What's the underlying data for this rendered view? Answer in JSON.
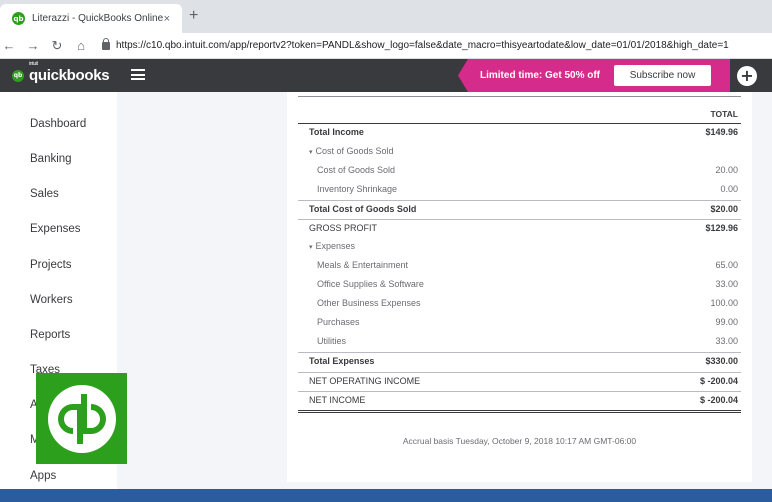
{
  "browser": {
    "tab_title": "Literazzi - QuickBooks Online",
    "tab_close": "×",
    "new_tab": "+",
    "favicon": "qb",
    "url": "https://c10.qbo.intuit.com/app/reportv2?token=PANDL&show_logo=false&date_macro=thisyeartodate&low_date=01/01/2018&high_date=1",
    "nav": {
      "back": "←",
      "forward": "→",
      "reload": "↻",
      "home": "⌂"
    }
  },
  "header": {
    "logo_badge": "qb",
    "logo_intuit": "intuit",
    "logo_text": "quickbooks",
    "promo_text": "Limited time: Get 50% off",
    "subscribe_label": "Subscribe now",
    "plus": "+"
  },
  "sidebar": {
    "items": [
      {
        "label": "Dashboard"
      },
      {
        "label": "Banking"
      },
      {
        "label": "Sales"
      },
      {
        "label": "Expenses"
      },
      {
        "label": "Projects"
      },
      {
        "label": "Workers"
      },
      {
        "label": "Reports"
      },
      {
        "label": "Taxes"
      },
      {
        "label": "A"
      },
      {
        "label": "M"
      },
      {
        "label": "Apps"
      }
    ]
  },
  "report": {
    "column_header": "TOTAL",
    "rows": [
      {
        "label": "Total Income",
        "value": "$149.96",
        "style": "bold",
        "indent": 0
      },
      {
        "label": "Cost of Goods Sold",
        "value": "",
        "style": "plain",
        "indent": 0,
        "caret": "▾"
      },
      {
        "label": "Cost of Goods Sold",
        "value": "20.00",
        "style": "plain",
        "indent": 1
      },
      {
        "label": "Inventory Shrinkage",
        "value": "0.00",
        "style": "plain",
        "indent": 1
      },
      {
        "label": "Total Cost of Goods Sold",
        "value": "$20.00",
        "style": "total",
        "indent": 0
      },
      {
        "label": "GROSS PROFIT",
        "value": "$129.96",
        "style": "net",
        "indent": 0
      },
      {
        "label": "Expenses",
        "value": "",
        "style": "plain",
        "indent": 0,
        "caret": "▾"
      },
      {
        "label": "Meals & Entertainment",
        "value": "65.00",
        "style": "plain",
        "indent": 1
      },
      {
        "label": "Office Supplies & Software",
        "value": "33.00",
        "style": "plain",
        "indent": 1
      },
      {
        "label": "Other Business Expenses",
        "value": "100.00",
        "style": "plain",
        "indent": 1
      },
      {
        "label": "Purchases",
        "value": "99.00",
        "style": "plain",
        "indent": 1
      },
      {
        "label": "Utilities",
        "value": "33.00",
        "style": "plain",
        "indent": 1
      },
      {
        "label": "Total Expenses",
        "value": "$330.00",
        "style": "total",
        "indent": 0
      },
      {
        "label": "NET OPERATING INCOME",
        "value": "$ -200.04",
        "style": "net",
        "indent": 0
      },
      {
        "label": "NET INCOME",
        "value": "$ -200.04",
        "style": "final",
        "indent": 0
      }
    ],
    "footer": "Accrual basis  Tuesday, October 9, 2018  10:17 AM GMT-06:00"
  },
  "colors": {
    "brand_green": "#2ca01c",
    "header_dark": "#393a3d",
    "promo_pink": "#d52b8b"
  }
}
